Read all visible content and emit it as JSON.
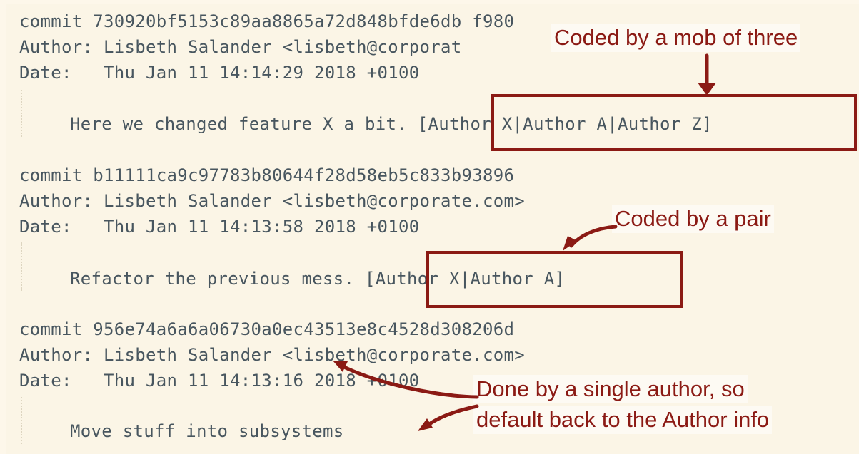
{
  "commits": [
    {
      "commit_line": "commit 730920bf5153c89aa8865a72d848bfde6db f980",
      "author_line": "Author: Lisbeth Salander <lisbeth@corporat",
      "date_line": "Date:   Thu Jan 11 14:14:29 2018 +0100",
      "message": "Here we changed feature X a bit.",
      "coauthors": "[Author X|Author A|Author Z]"
    },
    {
      "commit_line": "commit b11111ca9c97783b80644f28d58eb5c833b93896",
      "author_line": "Author: Lisbeth Salander <lisbeth@corporate.com>",
      "date_line": "Date:   Thu Jan 11 14:13:58 2018 +0100",
      "message": "Refactor the previous mess.",
      "coauthors": "[Author X|Author A]"
    },
    {
      "commit_line": "commit 956e74a6a6a06730a0ec43513e8c4528d308206d",
      "author_line": "Author: Lisbeth Salander <lisbeth@corporate.com>",
      "date_line": "Date:   Thu Jan 11 14:13:16 2018 +0100",
      "message": "Move stuff into subsystems",
      "coauthors": ""
    }
  ],
  "annotations": {
    "mob": "Coded by a mob of three",
    "pair": "Coded by a pair",
    "single_line1": "Done by a single author, so",
    "single_line2": "default back to the Author info"
  },
  "colors": {
    "background": "#fbf5e6",
    "text": "#48565f",
    "accent": "#8b1a14"
  }
}
